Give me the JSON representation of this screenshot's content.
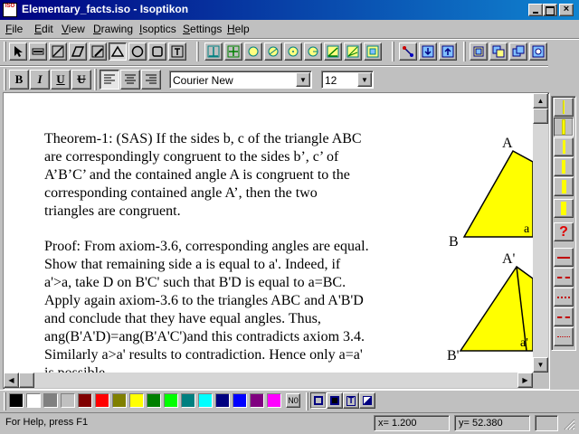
{
  "window": {
    "title": "Elementary_facts.iso - Isoptikon",
    "icon_text": "ISO"
  },
  "menu": [
    "File",
    "Edit",
    "View",
    "Drawing",
    "Isoptics",
    "Settings",
    "Help"
  ],
  "menu_mnemonics": [
    "F",
    "E",
    "V",
    "D",
    "I",
    "S",
    "H"
  ],
  "format_bar": {
    "bold_label": "B",
    "italic_label": "I",
    "underline_label": "U",
    "strike_label": "U",
    "font_name": "Courier New",
    "font_size": "12"
  },
  "document": {
    "theorem_lines": [
      "Theorem-1: (SAS) If the sides b, c of the triangle ABC",
      "are correspondingly congruent to the sides b’, c’ of",
      "A’B’C’ and the contained angle A is congruent to the",
      "corresponding contained angle A’, then the two",
      "triangles are congruent."
    ],
    "proof_lines": [
      "Proof: From axiom-3.6, corresponding angles are equal.",
      "Show that remaining side a is equal to a'. Indeed, if",
      "a'>a, take D on B'C' such that B'D is equal to a=BC.",
      "Apply again axiom-3.6 to the triangles ABC and A'B'D",
      "and conclude that they have equal angles. Thus,",
      "ang(B'A'D)=ang(B'A'C')and this contradicts axiom 3.4.",
      "Similarly a>a' results to contradiction. Hence only a=a'",
      "is possible."
    ],
    "figure_labels": {
      "top_A": "A",
      "top_B": "B",
      "top_a": "a",
      "bottom_A": "A'",
      "bottom_B": "B'",
      "bottom_a": "a'"
    },
    "triangle_fill": "#ffff00"
  },
  "colors": {
    "palette": [
      "#000000",
      "#ffffff",
      "#808080",
      "#c0c0c0",
      "#800000",
      "#ff0000",
      "#808000",
      "#ffff00",
      "#008000",
      "#00ff00",
      "#008080",
      "#00ffff",
      "#000080",
      "#0000ff",
      "#800080",
      "#ff00ff"
    ],
    "no_color_label": "N0"
  },
  "status": {
    "help": "For Help, press F1",
    "x": "x= 1.200",
    "y": "y= 52.380"
  }
}
